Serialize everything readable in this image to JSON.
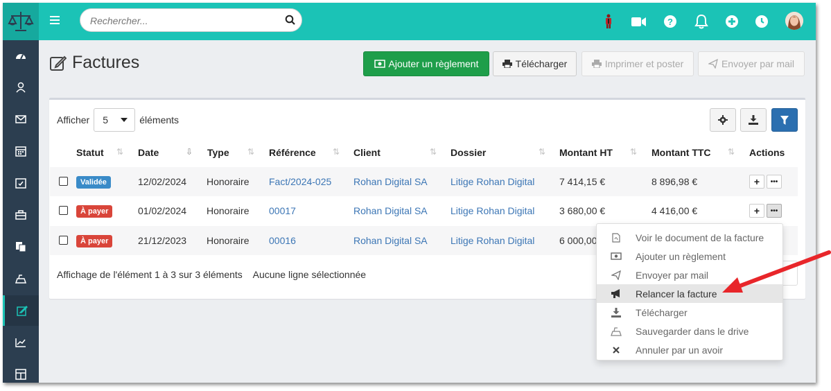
{
  "search": {
    "placeholder": "Rechercher..."
  },
  "topbar_icons": [
    "user-guide-icon",
    "video-icon",
    "help-icon",
    "bell-icon",
    "plus-icon",
    "clock-icon"
  ],
  "sidebar": {
    "items": [
      {
        "icon": "dashboard-icon"
      },
      {
        "icon": "contacts-icon"
      },
      {
        "icon": "mail-icon"
      },
      {
        "icon": "calendar-icon"
      },
      {
        "icon": "tasks-icon"
      },
      {
        "icon": "briefcase-icon"
      },
      {
        "icon": "documents-icon"
      },
      {
        "icon": "drive-icon"
      },
      {
        "icon": "invoices-icon",
        "active": true
      },
      {
        "icon": "stats-icon"
      },
      {
        "icon": "tables-icon"
      }
    ]
  },
  "page": {
    "title": "Factures",
    "buttons": {
      "add_payment": "Ajouter un règlement",
      "download": "Télécharger",
      "print": "Imprimer et poster",
      "email": "Envoyer par mail"
    }
  },
  "table": {
    "length_label_before": "Afficher",
    "length_value": "5",
    "length_label_after": "éléments",
    "columns": [
      "Statut",
      "Date",
      "Type",
      "Référence",
      "Client",
      "Dossier",
      "Montant HT",
      "Montant TTC",
      "Actions"
    ],
    "rows": [
      {
        "status": "Validée",
        "status_color": "#3a8bc8",
        "date": "12/02/2024",
        "type": "Honoraire",
        "reference": "Fact/2024-025",
        "client": "Rohan Digital SA",
        "dossier": "Litige Rohan Digital",
        "ht": "7 414,15 €",
        "ttc": "8 896,98 €"
      },
      {
        "status": "À payer",
        "status_color": "#d9453a",
        "date": "01/02/2024",
        "type": "Honoraire",
        "reference": "00017",
        "client": "Rohan Digital SA",
        "dossier": "Litige Rohan Digital",
        "ht": "3 680,00 €",
        "ttc": "4 416,00 €"
      },
      {
        "status": "À payer",
        "status_color": "#d9453a",
        "date": "21/12/2023",
        "type": "Honoraire",
        "reference": "00016",
        "client": "Rohan Digital SA",
        "dossier": "Litige Rohan Digital",
        "ht": "6 000,00",
        "ttc": ""
      }
    ],
    "info": "Affichage de l'élément 1 à 3 sur 3 éléments",
    "selection": "Aucune ligne sélectionnée"
  },
  "dropdown": {
    "items": [
      {
        "label": "Voir le document de la facture",
        "icon": "pdf-icon"
      },
      {
        "label": "Ajouter un règlement",
        "icon": "money-icon"
      },
      {
        "label": "Envoyer par mail",
        "icon": "send-icon"
      },
      {
        "label": "Relancer la facture",
        "icon": "megaphone-icon",
        "highlighted": true
      },
      {
        "label": "Télécharger",
        "icon": "download-icon"
      },
      {
        "label": "Sauvegarder dans le drive",
        "icon": "drive-icon"
      },
      {
        "label": "Annuler par un avoir",
        "icon": "cross-icon"
      }
    ]
  },
  "colors": {
    "topbar": "#1bc3b6",
    "sidebar": "#2c3e50",
    "primary_button": "#1e9e4a",
    "link": "#3c76b5",
    "annotation_arrow": "#e8262a"
  }
}
